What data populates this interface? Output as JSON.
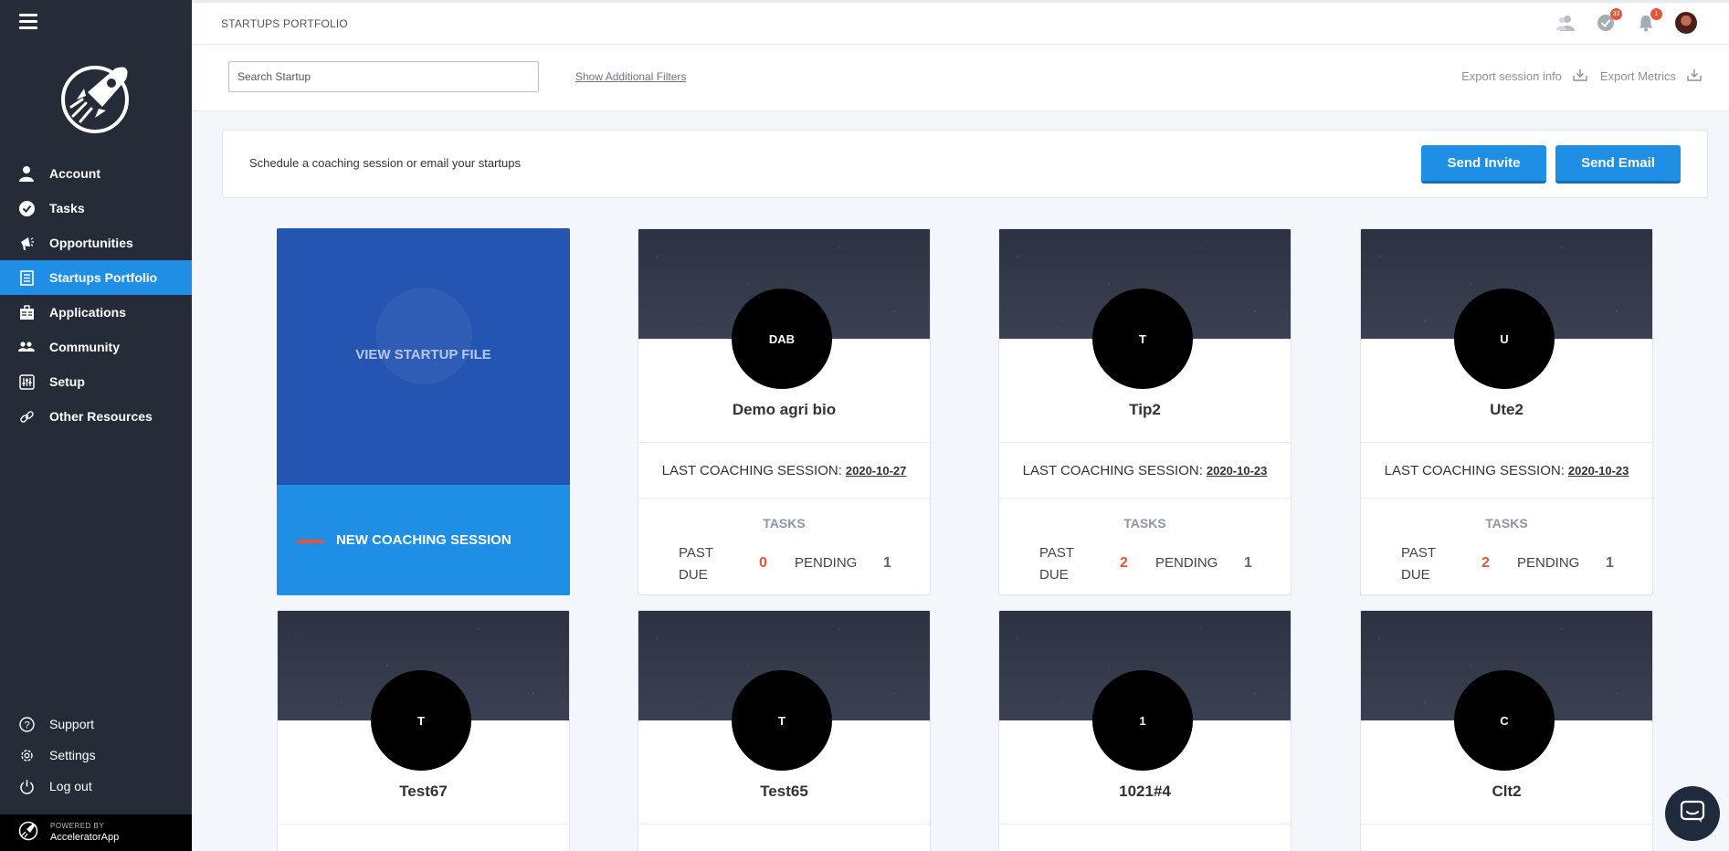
{
  "sidebar": {
    "items": [
      {
        "label": "Account",
        "icon": "user-icon"
      },
      {
        "label": "Tasks",
        "icon": "check-circle-icon"
      },
      {
        "label": "Opportunities",
        "icon": "megaphone-icon"
      },
      {
        "label": "Startups Portfolio",
        "icon": "portfolio-icon",
        "active": true
      },
      {
        "label": "Applications",
        "icon": "applications-icon"
      },
      {
        "label": "Community",
        "icon": "community-icon"
      },
      {
        "label": "Setup",
        "icon": "sliders-icon"
      },
      {
        "label": "Other Resources",
        "icon": "link-icon"
      }
    ],
    "bottom_items": [
      {
        "label": "Support",
        "icon": "question-icon"
      },
      {
        "label": "Settings",
        "icon": "gear-icon"
      },
      {
        "label": "Log out",
        "icon": "power-icon"
      }
    ],
    "powered_by": "POWERED BY",
    "brand": "AcceleratorApp"
  },
  "header": {
    "title": "STARTUPS PORTFOLIO",
    "tasks_badge": "33",
    "notifications_badge": "1"
  },
  "filters": {
    "search_placeholder": "Search Startup",
    "additional_filters": "Show Additional Filters",
    "export_session": "Export session info",
    "export_metrics": "Export Metrics"
  },
  "invite": {
    "text": "Schedule a coaching session or email your startups",
    "send_invite": "Send Invite",
    "send_email": "Send Email"
  },
  "hover_card": {
    "view_file": "VIEW STARTUP FILE",
    "new_session": "NEW COACHING SESSION"
  },
  "cards": [
    {
      "initials": "DAB",
      "name": "Demo agri bio",
      "session_label": "LAST COACHING SESSION:",
      "session_date": "2020-10-27",
      "tasks_label": "TASKS",
      "past_due_label": "PAST DUE",
      "past_due": "0",
      "pending_label": "PENDING",
      "pending": "1"
    },
    {
      "initials": "T",
      "name": "Tip2",
      "session_label": "LAST COACHING SESSION:",
      "session_date": "2020-10-23",
      "tasks_label": "TASKS",
      "past_due_label": "PAST DUE",
      "past_due": "2",
      "pending_label": "PENDING",
      "pending": "1"
    },
    {
      "initials": "U",
      "name": "Ute2",
      "session_label": "LAST COACHING SESSION:",
      "session_date": "2020-10-23",
      "tasks_label": "TASKS",
      "past_due_label": "PAST DUE",
      "past_due": "2",
      "pending_label": "PENDING",
      "pending": "1"
    },
    {
      "initials": "T",
      "name": "Test67"
    },
    {
      "initials": "T",
      "name": "Test65"
    },
    {
      "initials": "1",
      "name": "1021#4"
    },
    {
      "initials": "C",
      "name": "Clt2"
    }
  ],
  "colors": {
    "sidebar_bg": "#252c37",
    "accent": "#1f8fe5",
    "hover_overlay": "#2455b3",
    "past_due": "#e4553a"
  }
}
